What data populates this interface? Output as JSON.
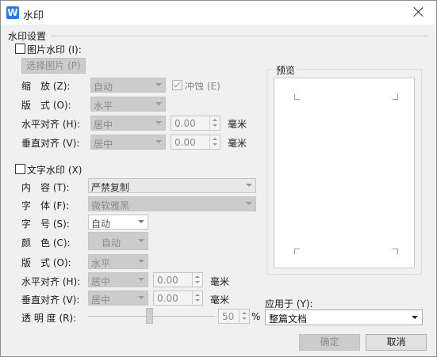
{
  "window": {
    "title": "水印",
    "icon": "wps-logo-icon"
  },
  "section_title": "水印设置",
  "picture_watermark": {
    "checkbox_label": "图片水印 (I):",
    "select_button": "选择图片 (P)",
    "scale_label": "缩　放 (Z):",
    "scale_value": "自动",
    "washout_label": "冲蚀 (E)",
    "washout_checked": true,
    "layout_label": "版　式 (O):",
    "layout_value": "水平",
    "h_align_label": "水平对齐 (H):",
    "h_align_value": "居中",
    "h_offset": "0.00",
    "h_unit": "毫米",
    "v_align_label": "垂直对齐 (V):",
    "v_align_value": "居中",
    "v_offset": "0.00",
    "v_unit": "毫米"
  },
  "text_watermark": {
    "checkbox_label": "文字水印 (X)",
    "content_label": "内　容 (T):",
    "content_value": "严禁复制",
    "font_label": "字　体 (F):",
    "font_value": "微软雅黑",
    "size_label": "字　号 (S):",
    "size_value": "自动",
    "color_label": "颜　色 (C):",
    "color_value": "自动",
    "layout_label": "版　式 (O):",
    "layout_value": "水平",
    "h_align_label": "水平对齐 (H):",
    "h_align_value": "居中",
    "h_offset": "0.00",
    "h_unit": "毫米",
    "v_align_label": "垂直对齐 (V):",
    "v_align_value": "居中",
    "v_offset": "0.00",
    "v_unit": "毫米",
    "transparency_label": "透 明 度 (R):",
    "transparency_value": "50",
    "transparency_unit": "%"
  },
  "preview": {
    "label": "预览"
  },
  "apply_to": {
    "label": "应用于 (Y):",
    "value": "整篇文档"
  },
  "buttons": {
    "ok": "确定",
    "cancel": "取消"
  },
  "colors": {
    "accent": "#2b79ea",
    "disabled_bg": "#cccccc",
    "dialog_bg": "#f0f0f0"
  }
}
